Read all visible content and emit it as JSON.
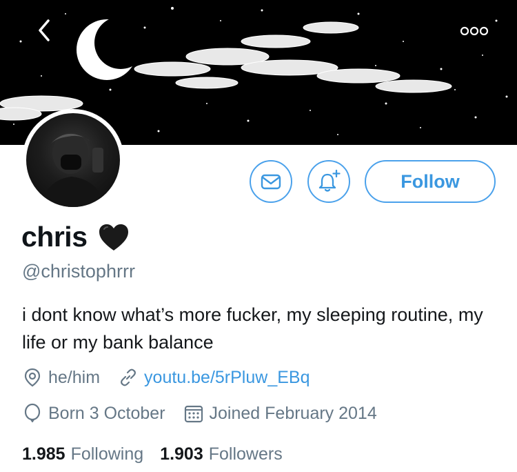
{
  "icons": {
    "back": "chevron-left-icon",
    "more": "more-horizontal-icon",
    "message": "envelope-icon",
    "notifications": "bell-plus-icon",
    "location": "location-pin-icon",
    "website": "link-icon",
    "birthday": "balloon-icon",
    "joined": "calendar-icon",
    "emoji": "black-heart-icon"
  },
  "colors": {
    "accent": "#3a97e0",
    "muted": "#657786",
    "text": "#14171a",
    "banner": "#000000"
  },
  "profile": {
    "follow_label": "Follow",
    "display_name": "chris",
    "handle": "@christophrrr",
    "bio": "i dont know what’s more fucker, my sleeping routine, my life or my bank balance",
    "location": "he/him",
    "website": "youtu.be/5rPluw_EBq",
    "birthday": "Born 3 October",
    "joined": "Joined February 2014"
  },
  "stats": {
    "following_count": "1.985",
    "following_label": "Following",
    "followers_count": "1.903",
    "followers_label": "Followers"
  }
}
